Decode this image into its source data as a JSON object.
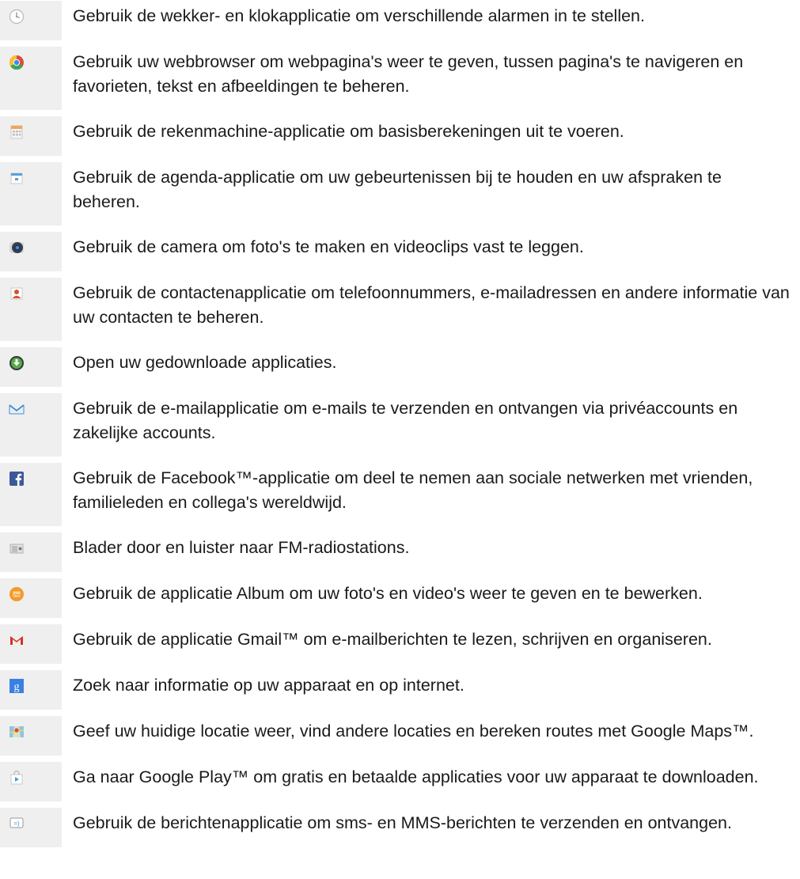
{
  "apps": [
    {
      "icon": "alarm-clock-icon",
      "text": "Gebruik de wekker- en klokapplicatie om verschillende alarmen in te stellen."
    },
    {
      "icon": "chrome-browser-icon",
      "text": "Gebruik uw webbrowser om webpagina's weer te geven, tussen pagina's te navigeren en favorieten, tekst en afbeeldingen te beheren."
    },
    {
      "icon": "calculator-icon",
      "text": "Gebruik de rekenmachine-applicatie om basisberekeningen uit te voeren."
    },
    {
      "icon": "calendar-icon",
      "text": "Gebruik de agenda-applicatie om uw gebeurtenissen bij te houden en uw afspraken te beheren."
    },
    {
      "icon": "camera-icon",
      "text": "Gebruik de camera om foto's te maken en videoclips vast te leggen."
    },
    {
      "icon": "contacts-icon",
      "text": "Gebruik de contactenapplicatie om telefoonnummers, e-mailadressen en andere informatie van uw contacten te beheren."
    },
    {
      "icon": "downloads-icon",
      "text": "Open uw gedownloade applicaties."
    },
    {
      "icon": "email-icon",
      "text": "Gebruik de e-mailapplicatie om e-mails te verzenden en ontvangen via privéaccounts en zakelijke accounts."
    },
    {
      "icon": "facebook-icon",
      "text": "Gebruik de Facebook™-applicatie om deel te nemen aan sociale netwerken met vrienden, familieleden en collega's wereldwijd."
    },
    {
      "icon": "fm-radio-icon",
      "text": "Blader door en luister naar FM-radiostations."
    },
    {
      "icon": "album-icon",
      "text": "Gebruik de applicatie Album om uw foto's en video's weer te geven en te bewerken."
    },
    {
      "icon": "gmail-icon",
      "text": "Gebruik de applicatie Gmail™ om e-mailberichten te lezen, schrijven en organiseren."
    },
    {
      "icon": "google-search-icon",
      "text": "Zoek naar informatie op uw apparaat en op internet."
    },
    {
      "icon": "google-maps-icon",
      "text": "Geef uw huidige locatie weer, vind andere locaties en bereken routes met Google Maps™."
    },
    {
      "icon": "google-play-icon",
      "text": "Ga naar Google Play™ om gratis en betaalde applicaties voor uw apparaat te downloaden."
    },
    {
      "icon": "messaging-icon",
      "text": "Gebruik de berichtenapplicatie om sms- en MMS-berichten te verzenden en ontvangen."
    }
  ]
}
